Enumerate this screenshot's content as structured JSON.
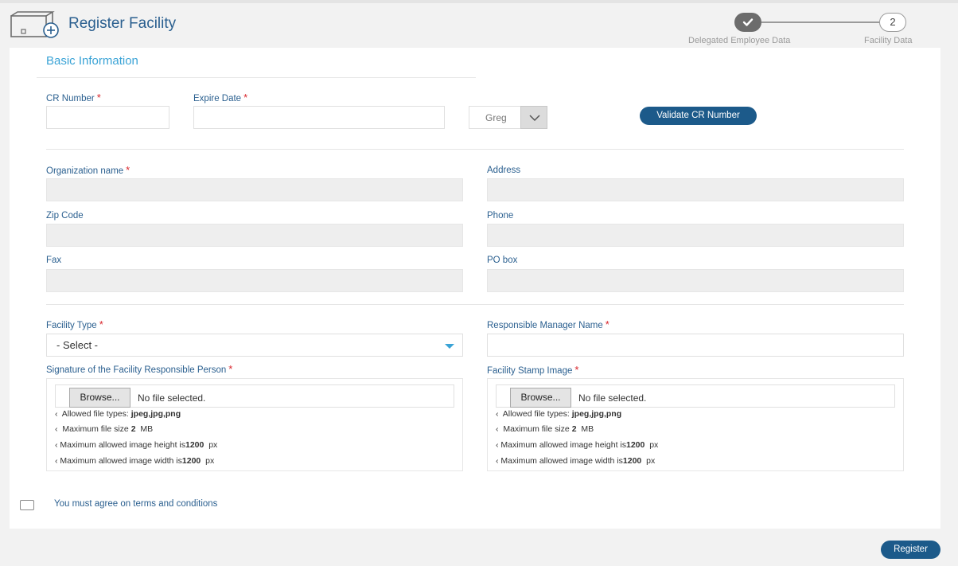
{
  "header": {
    "title": "Register Facility"
  },
  "steps": [
    {
      "number": "",
      "label": "Delegated Employee Data",
      "state": "completed"
    },
    {
      "number": "2",
      "label": "Facility Data",
      "state": "current"
    }
  ],
  "form": {
    "section_title": "Basic Information",
    "cr_number": {
      "label": "CR Number",
      "required": "*",
      "value": ""
    },
    "expire_date": {
      "label": "Expire Date",
      "required": "*",
      "value": ""
    },
    "calendar": {
      "selected": "Greg"
    },
    "validate_button": "Validate CR Number",
    "organization_name": {
      "label": "Organization name",
      "required": "*"
    },
    "address": {
      "label": "Address"
    },
    "zip_code": {
      "label": "Zip Code"
    },
    "phone": {
      "label": "Phone"
    },
    "fax": {
      "label": "Fax"
    },
    "po_box": {
      "label": "PO box"
    },
    "facility_type": {
      "label": "Facility Type",
      "required": "*",
      "selected": "- Select -"
    },
    "manager_name": {
      "label": "Responsible Manager Name",
      "required": "*"
    },
    "signature": {
      "label": "Signature of the Facility Responsible Person",
      "required": "*",
      "browse": "Browse...",
      "file_status": "No file selected."
    },
    "stamp": {
      "label": "Facility Stamp Image",
      "required": "*",
      "browse": "Browse...",
      "file_status": "No file selected."
    },
    "upload_rules": {
      "bullet": "‹",
      "types_prefix": "Allowed file types:",
      "types_value": "jpeg,jpg,png",
      "size_prefix": "Maximum file size",
      "size_value": "2",
      "size_unit": "MB",
      "height_prefix": "Maximum allowed image height is",
      "height_value": "1200",
      "height_unit": "px",
      "width_prefix": "Maximum allowed image width is",
      "width_value": "1200",
      "width_unit": "px"
    },
    "terms": "You must agree on terms and conditions"
  },
  "register_button": "Register",
  "colors": {
    "accent": "#3aa3d6",
    "primary_button": "#1c5a8a",
    "label": "#2a5f8f",
    "required": "#d9262c"
  }
}
